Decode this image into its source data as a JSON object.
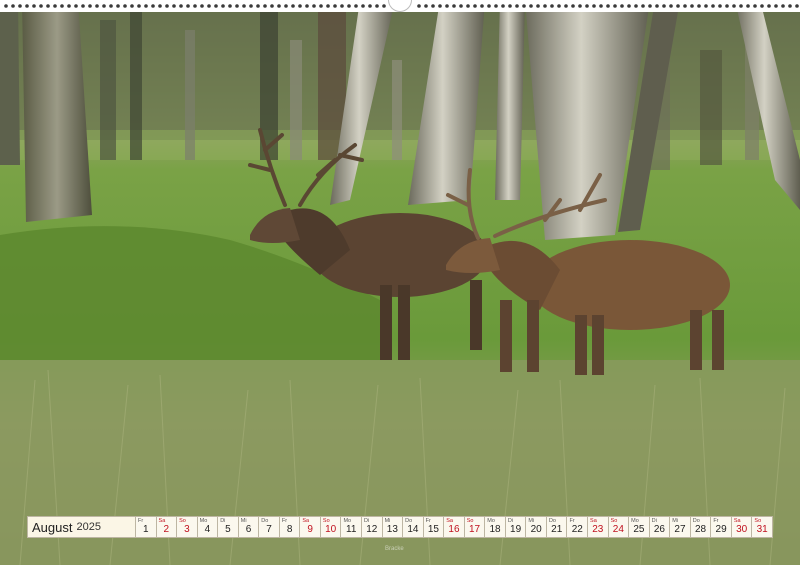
{
  "calendar": {
    "month": "August",
    "year": "2025",
    "weekend_color": "#c0111f",
    "days": [
      {
        "wd": "Fr",
        "num": "1",
        "weekend": false
      },
      {
        "wd": "Sa",
        "num": "2",
        "weekend": true
      },
      {
        "wd": "So",
        "num": "3",
        "weekend": true
      },
      {
        "wd": "Mo",
        "num": "4",
        "weekend": false
      },
      {
        "wd": "Di",
        "num": "5",
        "weekend": false
      },
      {
        "wd": "Mi",
        "num": "6",
        "weekend": false
      },
      {
        "wd": "Do",
        "num": "7",
        "weekend": false
      },
      {
        "wd": "Fr",
        "num": "8",
        "weekend": false
      },
      {
        "wd": "Sa",
        "num": "9",
        "weekend": true
      },
      {
        "wd": "So",
        "num": "10",
        "weekend": true
      },
      {
        "wd": "Mo",
        "num": "11",
        "weekend": false
      },
      {
        "wd": "Di",
        "num": "12",
        "weekend": false
      },
      {
        "wd": "Mi",
        "num": "13",
        "weekend": false
      },
      {
        "wd": "Do",
        "num": "14",
        "weekend": false
      },
      {
        "wd": "Fr",
        "num": "15",
        "weekend": false
      },
      {
        "wd": "Sa",
        "num": "16",
        "weekend": true
      },
      {
        "wd": "So",
        "num": "17",
        "weekend": true
      },
      {
        "wd": "Mo",
        "num": "18",
        "weekend": false
      },
      {
        "wd": "Di",
        "num": "19",
        "weekend": false
      },
      {
        "wd": "Mi",
        "num": "20",
        "weekend": false
      },
      {
        "wd": "Do",
        "num": "21",
        "weekend": false
      },
      {
        "wd": "Fr",
        "num": "22",
        "weekend": false
      },
      {
        "wd": "Sa",
        "num": "23",
        "weekend": true
      },
      {
        "wd": "So",
        "num": "24",
        "weekend": true
      },
      {
        "wd": "Mo",
        "num": "25",
        "weekend": false
      },
      {
        "wd": "Di",
        "num": "26",
        "weekend": false
      },
      {
        "wd": "Mi",
        "num": "27",
        "weekend": false
      },
      {
        "wd": "Do",
        "num": "28",
        "weekend": false
      },
      {
        "wd": "Fr",
        "num": "29",
        "weekend": false
      },
      {
        "wd": "Sa",
        "num": "30",
        "weekend": true
      },
      {
        "wd": "So",
        "num": "31",
        "weekend": true
      }
    ]
  },
  "credit": "Bracke",
  "photo": {
    "subject": "two-red-deer-stags-icon",
    "sky_color": "#8a9a6a",
    "meadow_color": "#6e9a3a",
    "grass_color": "#8a9a5a"
  }
}
